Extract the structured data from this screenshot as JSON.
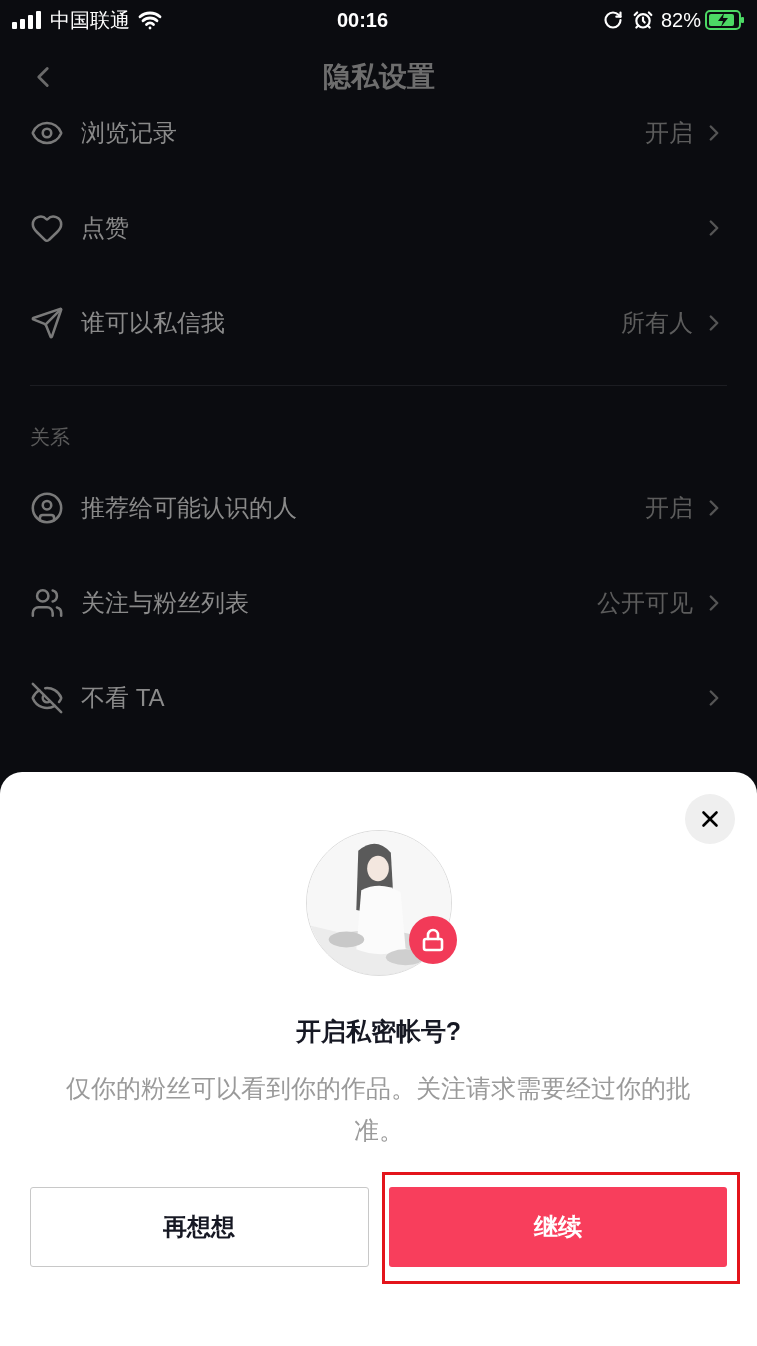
{
  "status_bar": {
    "carrier": "中国联通",
    "time": "00:16",
    "battery": "82%"
  },
  "nav": {
    "title": "隐私设置"
  },
  "sections": [
    {
      "items": [
        {
          "label": "浏览记录",
          "value": "开启"
        },
        {
          "label": "点赞"
        },
        {
          "label": "谁可以私信我",
          "value": "所有人"
        }
      ]
    },
    {
      "header": "关系",
      "items": [
        {
          "label": "推荐给可能认识的人",
          "value": "开启"
        },
        {
          "label": "关注与粉丝列表",
          "value": "公开可见"
        },
        {
          "label": "不看 TA"
        }
      ]
    }
  ],
  "dialog": {
    "title": "开启私密帐号?",
    "message": "仅你的粉丝可以看到你的作品。关注请求需要经过你的批准。",
    "buttons": [
      {
        "kind": "secondary",
        "label": "再想想",
        "highlighted": false
      },
      {
        "kind": "primary",
        "label": "继续",
        "highlighted": true
      }
    ]
  }
}
